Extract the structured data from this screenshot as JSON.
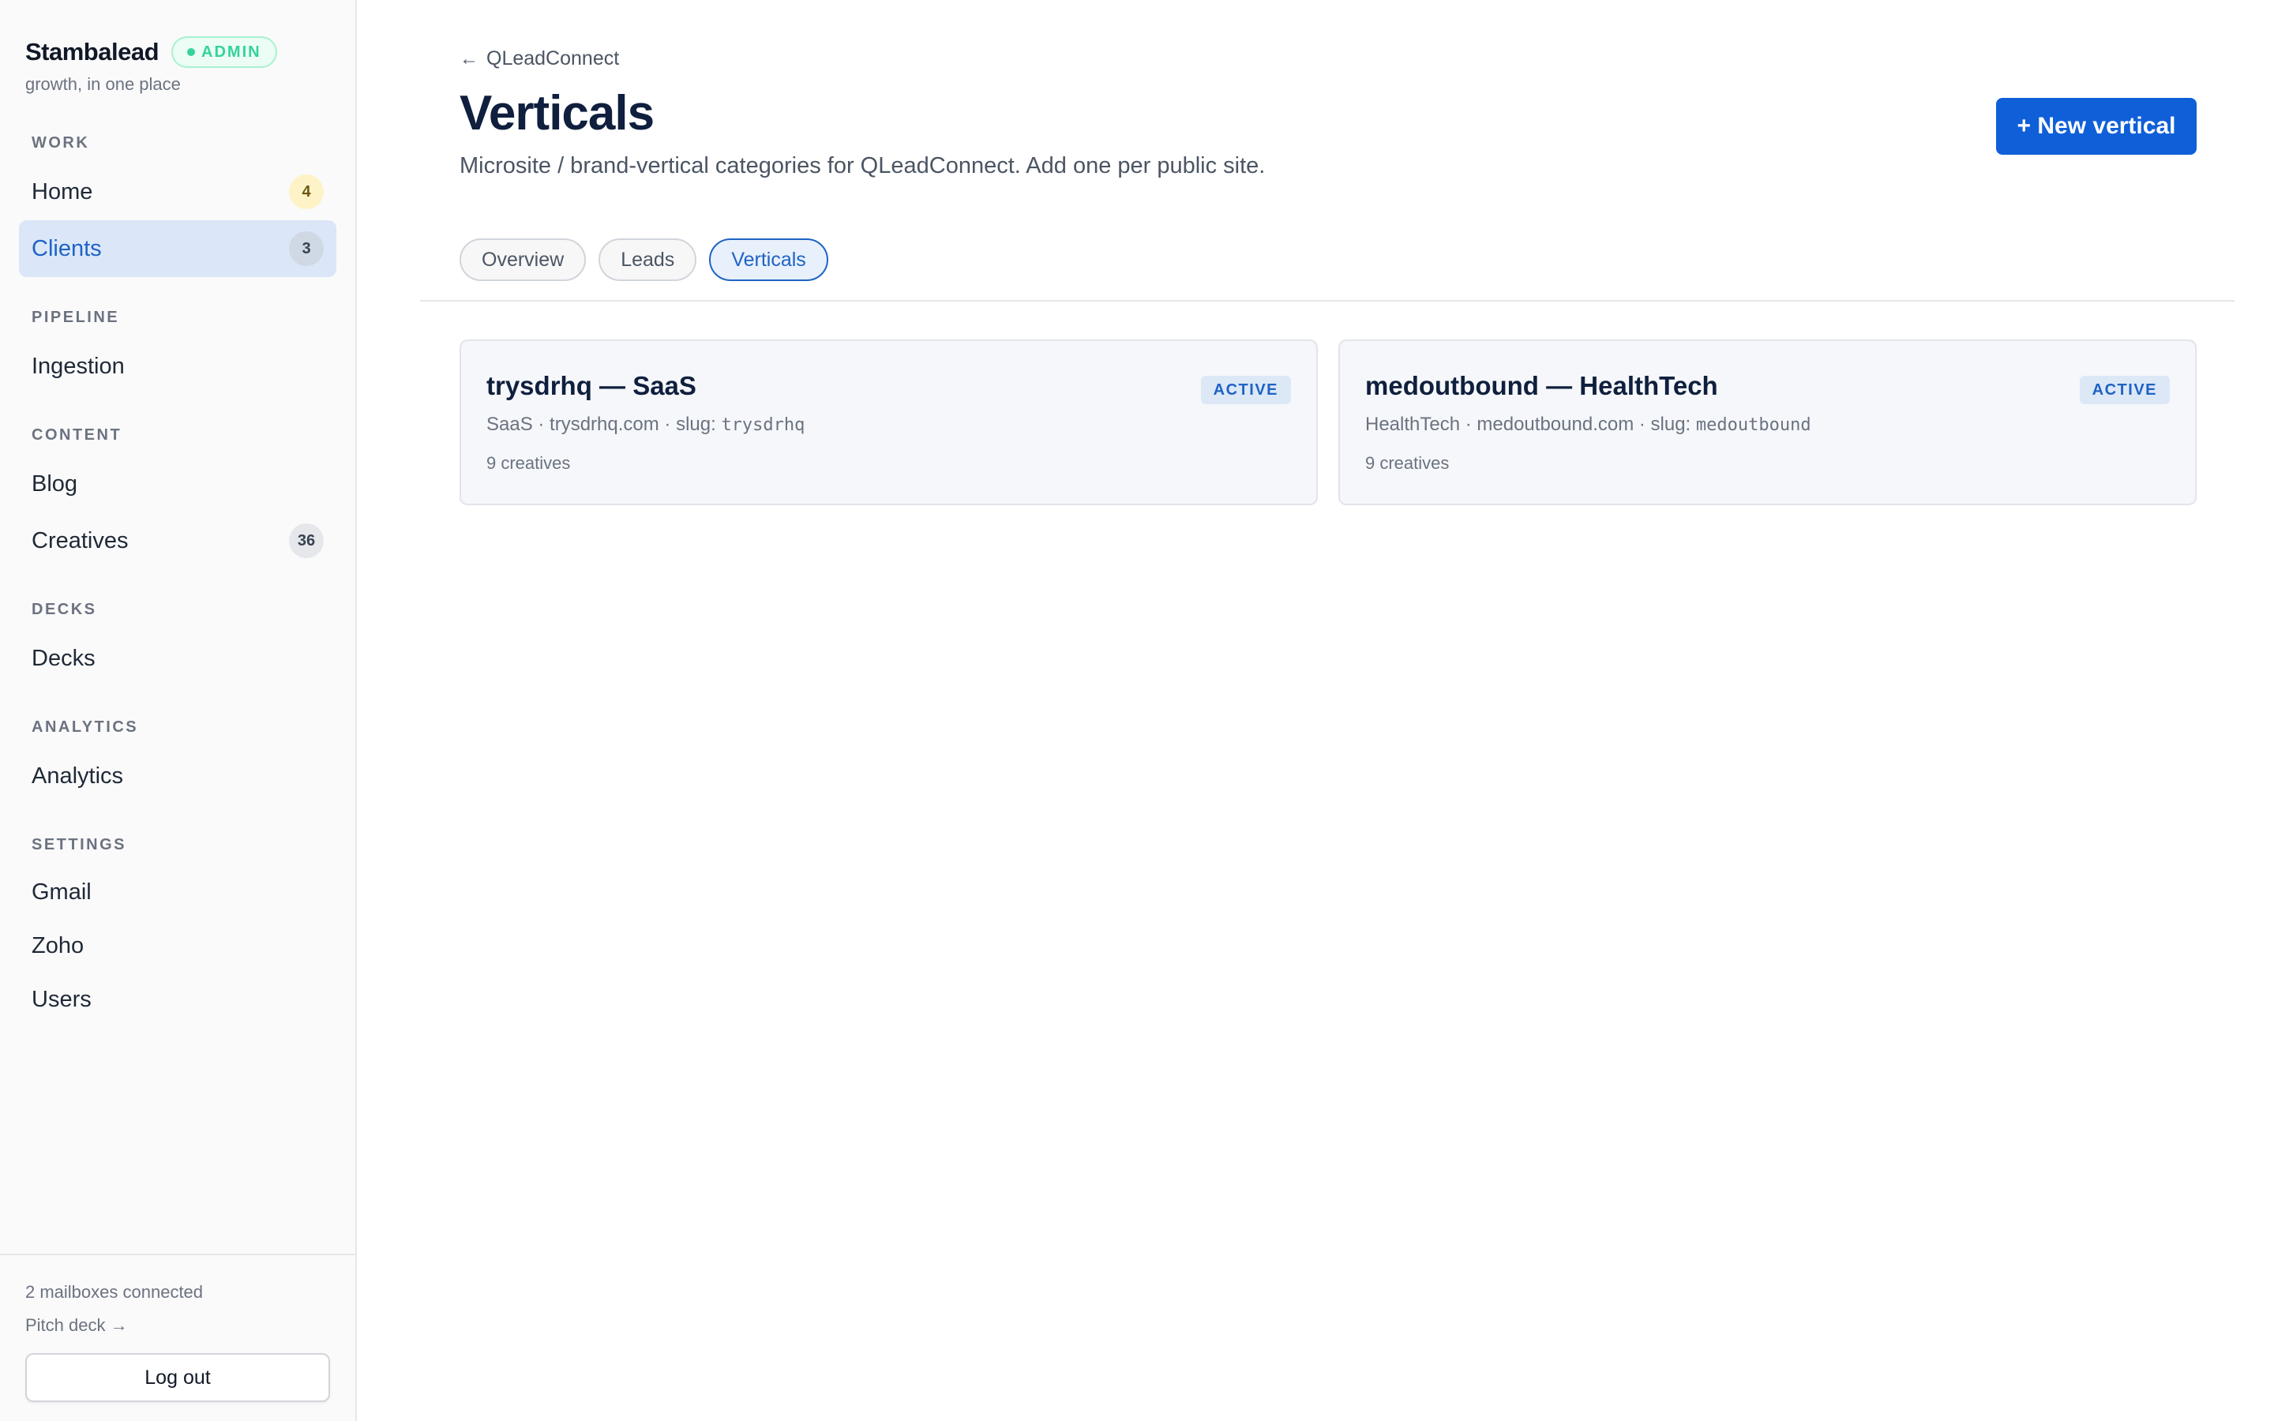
{
  "brand": {
    "name": "Stambalead",
    "badge": "ADMIN",
    "tagline": "growth, in one place"
  },
  "sidebar": {
    "sections": [
      {
        "label": "WORK",
        "items": [
          {
            "label": "Home",
            "count": "4",
            "active": false
          },
          {
            "label": "Clients",
            "count": "3",
            "active": true
          }
        ]
      },
      {
        "label": "PIPELINE",
        "items": [
          {
            "label": "Ingestion"
          }
        ]
      },
      {
        "label": "CONTENT",
        "items": [
          {
            "label": "Blog"
          },
          {
            "label": "Creatives",
            "count": "36"
          }
        ]
      },
      {
        "label": "DECKS",
        "items": [
          {
            "label": "Decks"
          }
        ]
      },
      {
        "label": "ANALYTICS",
        "items": [
          {
            "label": "Analytics"
          }
        ]
      },
      {
        "label": "SETTINGS",
        "items": [
          {
            "label": "Gmail"
          },
          {
            "label": "Zoho"
          },
          {
            "label": "Users"
          }
        ]
      }
    ],
    "footer": {
      "mailboxes": "2 mailboxes connected",
      "pitch_deck": "Pitch deck →",
      "logout": "Log out"
    }
  },
  "main": {
    "back_link": "QLeadConnect",
    "back_arrow": "←",
    "title": "Verticals",
    "subtitle": "Microsite / brand-vertical categories for QLeadConnect. Add one per public site.",
    "new_button": "+ New vertical",
    "tabs": [
      {
        "label": "Overview",
        "active": false
      },
      {
        "label": "Leads",
        "active": false
      },
      {
        "label": "Verticals",
        "active": true
      }
    ],
    "cards": [
      {
        "title": "trysdrhq — SaaS",
        "status": "ACTIVE",
        "meta_prefix": "SaaS · trysdrhq.com · slug:",
        "slug": "trysdrhq",
        "creatives": "9 creatives"
      },
      {
        "title": "medoutbound — HealthTech",
        "status": "ACTIVE",
        "meta_prefix": "HealthTech · medoutbound.com · slug:",
        "slug": "medoutbound",
        "creatives": "9 creatives"
      }
    ]
  },
  "colors": {
    "accent": "#0f5fd8",
    "active_nav_bg": "#dbe7f8",
    "admin_green": "#34d399"
  }
}
